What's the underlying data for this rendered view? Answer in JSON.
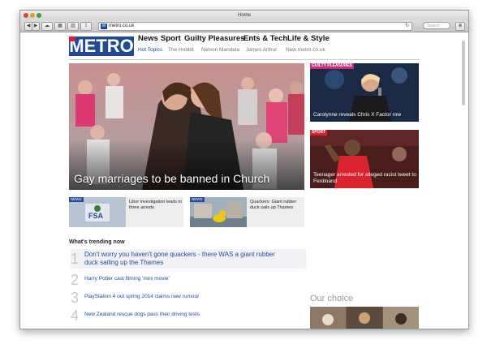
{
  "window": {
    "title": "Home",
    "url": "metro.co.uk",
    "search_placeholder": "Search"
  },
  "toolbar": {
    "back_icon": "back-arrow-icon",
    "forward_icon": "forward-arrow-icon",
    "reload_icon": "reload-icon"
  },
  "header": {
    "logo": "METRO",
    "nav": [
      "News",
      "Sport",
      "Guilty Pleasures",
      "Ents & Tech",
      "Life & Style"
    ],
    "subnav": [
      "Hot Topics",
      "The Hobbit",
      "Nelson Mandela",
      "James Arthur",
      "New metro.co.uk"
    ]
  },
  "main_story": {
    "headline": "Gay marriages to be banned in Church"
  },
  "side_stories": [
    {
      "tag": "GUILTY PLEASURES",
      "caption": "Carolynne reveals Chris X Factor row",
      "tag_color": "#c0307a"
    },
    {
      "tag": "SPORT",
      "caption": "Teenager arrested for alleged racist tweet to Ferdinand",
      "tag_color": "#d9232e"
    }
  ],
  "small_stories": [
    {
      "tag": "NEWS",
      "caption": "Libor investigation leads to three arrests",
      "thumb_text": "FSA"
    },
    {
      "tag": "NEWS",
      "caption": "Quackers: Giant rubber duck sails up Thames"
    }
  ],
  "trending": {
    "heading": "What's trending now",
    "items": [
      {
        "num": "1",
        "text": "Don't worry you haven't gone quackers - there WAS a giant rubber duck sailing up the Thames"
      },
      {
        "num": "2",
        "text": "Harry Potter cast filming 'mini movie'"
      },
      {
        "num": "3",
        "text": "PlayStation 4 out spring 2014 claims new rumour"
      },
      {
        "num": "4",
        "text": "New Zealand rescue dogs pass their driving tests"
      }
    ]
  },
  "our_choice": {
    "heading": "Our choice"
  },
  "gallery": {
    "prev": "〈",
    "next": "〉"
  },
  "colors": {
    "brand": "#1f4b96",
    "link": "#1f4b96"
  }
}
